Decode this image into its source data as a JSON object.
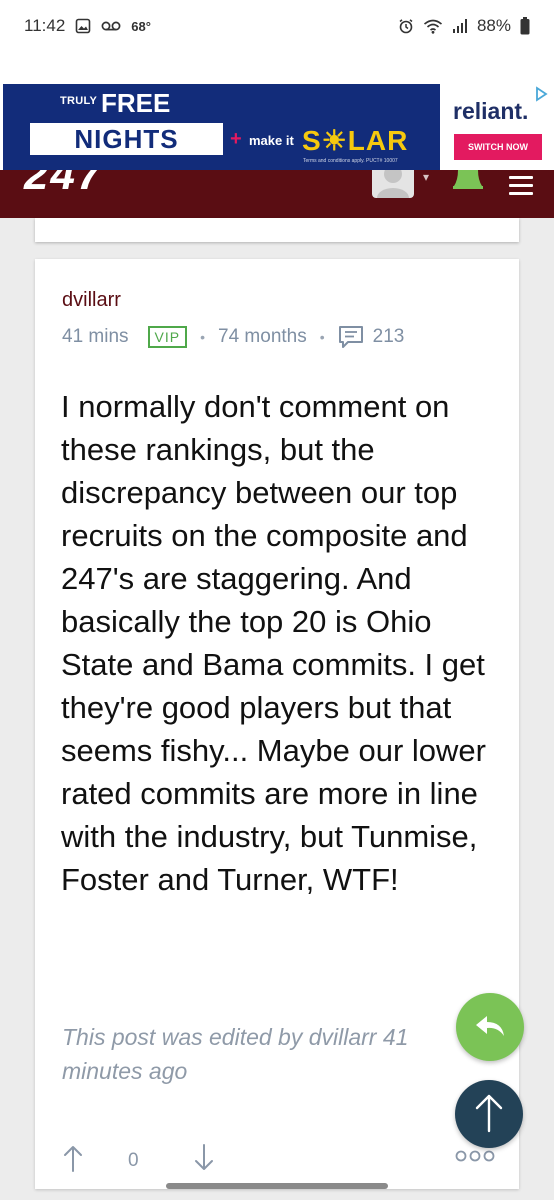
{
  "status_bar": {
    "time": "11:42",
    "temperature": "68°",
    "battery": "88%",
    "icons": [
      "gallery-icon",
      "voicemail-icon",
      "alarm-icon",
      "wifi-icon",
      "signal-icon",
      "battery-icon"
    ]
  },
  "ad": {
    "truly": "TRULY",
    "free": "FREE",
    "nights": "NIGHTS",
    "plus": "+",
    "make_it": "make it",
    "solar": "S☀LAR",
    "terms": "Terms and conditions apply. PUCT# 10007",
    "brand": "reliant.",
    "cta": "SWITCH NOW",
    "colors": {
      "background": "#122c7a",
      "accent": "#e31a60",
      "solar": "#f6c90e"
    }
  },
  "site_header": {
    "logo_text": "247",
    "notification_count": "0",
    "colors": {
      "background": "#5a0d13",
      "bell": "#7bc356"
    }
  },
  "post": {
    "username": "dvillarr",
    "time_ago": "41 mins",
    "badge": "VIP",
    "tenure": "74 months",
    "separator": "•",
    "post_count": "213",
    "body": "I normally don't comment on these rankings, but the discrepancy between our top recruits on the composite and 247's are staggering. And basically the top 20 is Ohio State and Bama commits. I get they're good players but that seems fishy... Maybe our lower rated commits are more in line with the industry, but Tunmise, Foster and Turner, WTF!",
    "edit_note": "This post was edited by dvillarr 41 minutes ago",
    "vote_count": "0"
  },
  "colors": {
    "username": "#5a0d13",
    "vip": "#4fa84a",
    "reply_fab": "#7bc356",
    "top_fab": "#234257"
  }
}
